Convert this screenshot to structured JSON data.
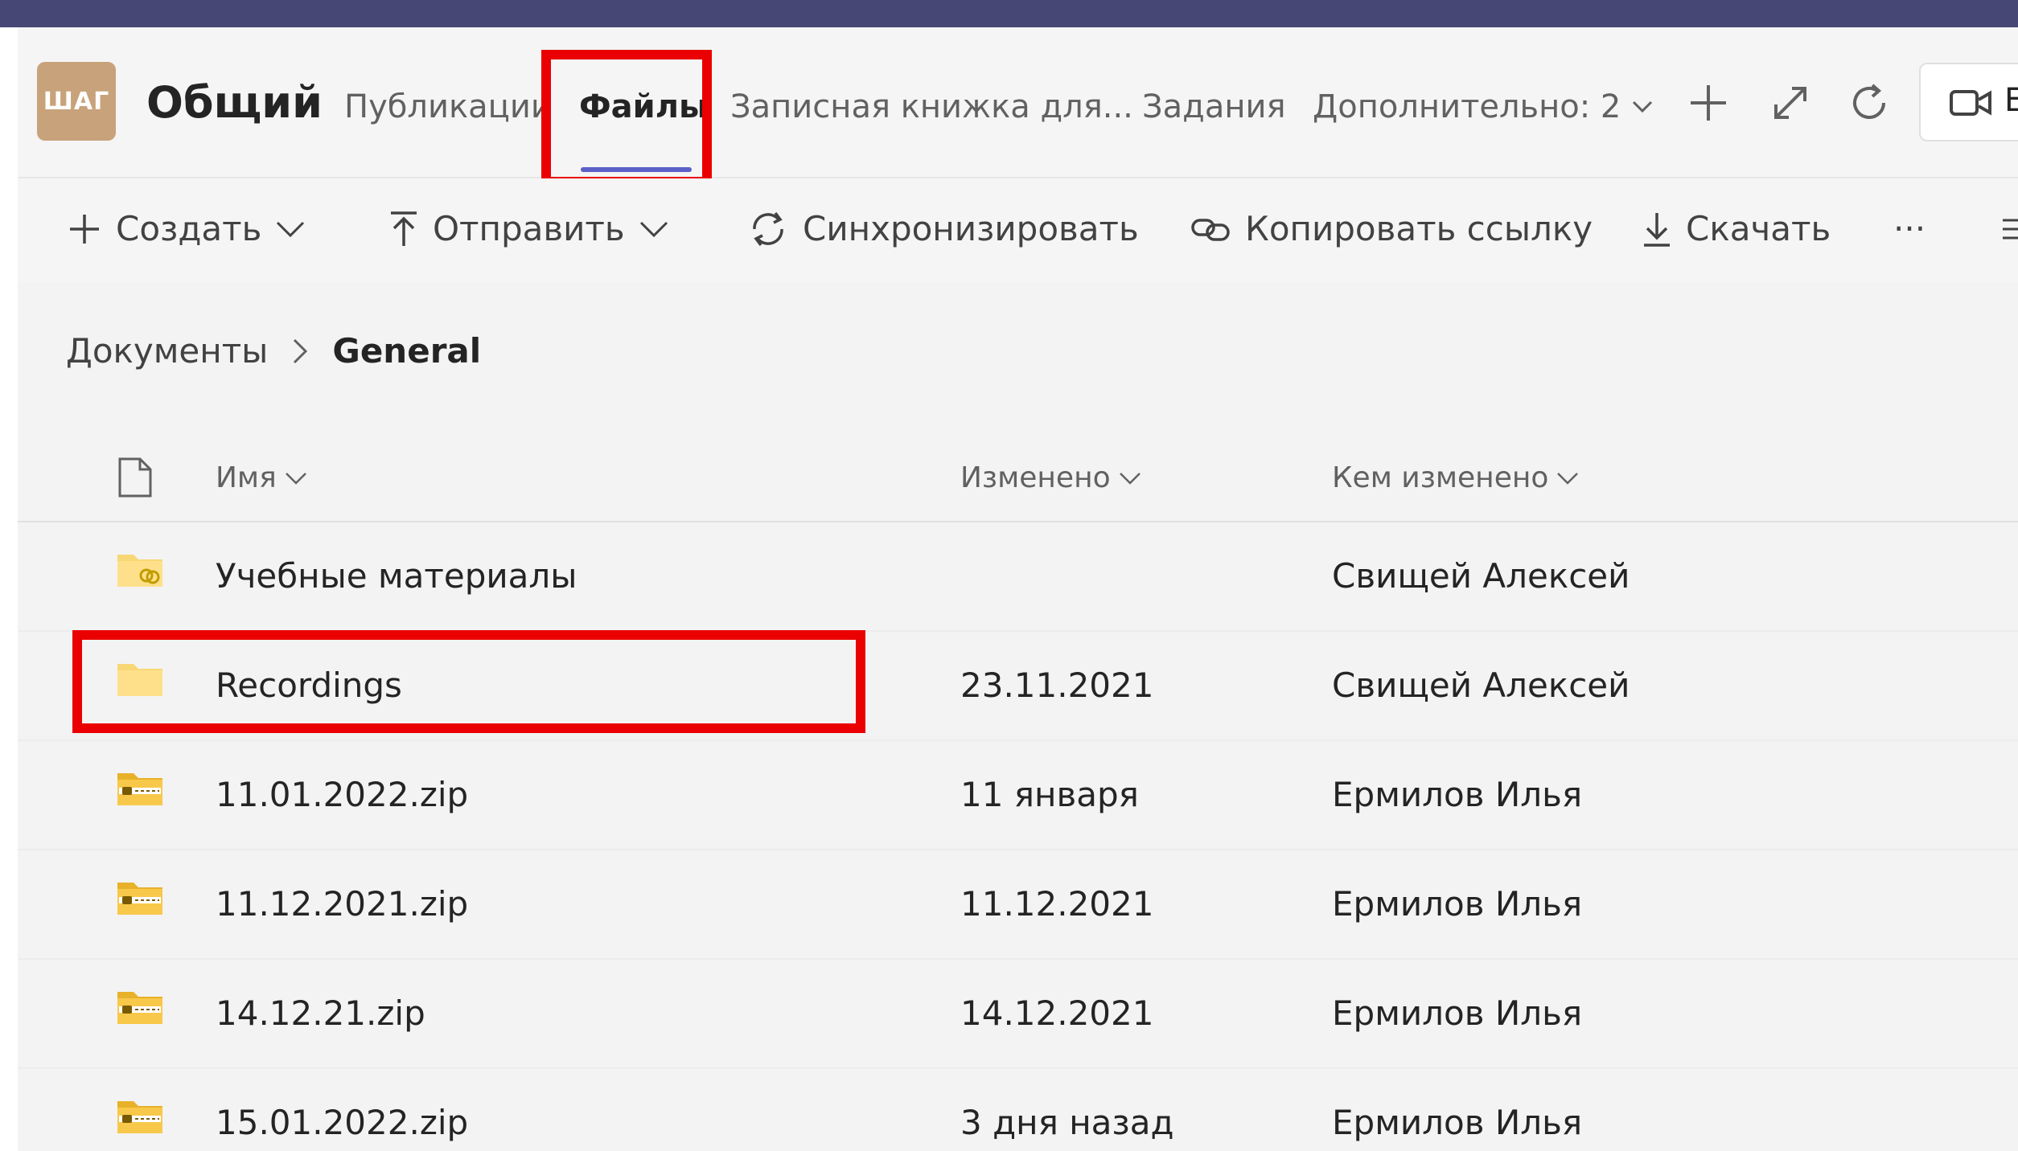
{
  "channel": {
    "avatar_text": "ШАГ",
    "title": "Общий",
    "tabs": [
      {
        "label": "Публикации",
        "active": false
      },
      {
        "label": "Файлы",
        "active": true
      },
      {
        "label": "Записная книжка для...",
        "active": false
      },
      {
        "label": "Задания",
        "active": false
      },
      {
        "label": "Дополнительно: 2",
        "active": false
      }
    ],
    "meet_label": "E"
  },
  "toolbar": {
    "create": "Создать",
    "upload": "Отправить",
    "sync": "Синхронизировать",
    "copy_link": "Копировать ссылку",
    "download": "Скачать",
    "more": "···"
  },
  "breadcrumb": {
    "root": "Документы",
    "current": "General"
  },
  "table": {
    "columns": {
      "name": "Имя",
      "modified": "Изменено",
      "modified_by": "Кем изменено"
    },
    "rows": [
      {
        "name": "Учебные материалы",
        "modified": "",
        "modified_by": "Свищей Алексей",
        "icon": "shared-folder-icon"
      },
      {
        "name": "Recordings",
        "modified": "23.11.2021",
        "modified_by": "Свищей Алексей",
        "icon": "folder-icon"
      },
      {
        "name": "11.01.2022.zip",
        "modified": "11 января",
        "modified_by": "Ермилов Илья",
        "icon": "zip-icon"
      },
      {
        "name": "11.12.2021.zip",
        "modified": "11.12.2021",
        "modified_by": "Ермилов Илья",
        "icon": "zip-icon"
      },
      {
        "name": "14.12.21.zip",
        "modified": "14.12.2021",
        "modified_by": "Ермилов Илья",
        "icon": "zip-icon"
      },
      {
        "name": "15.01.2022.zip",
        "modified": "3 дня назад",
        "modified_by": "Ермилов Илья",
        "icon": "zip-icon"
      }
    ]
  },
  "colors": {
    "highlight": "#ea0000",
    "accent": "#5b5fc7",
    "topbar": "#464775",
    "folder": "#f8d775"
  }
}
